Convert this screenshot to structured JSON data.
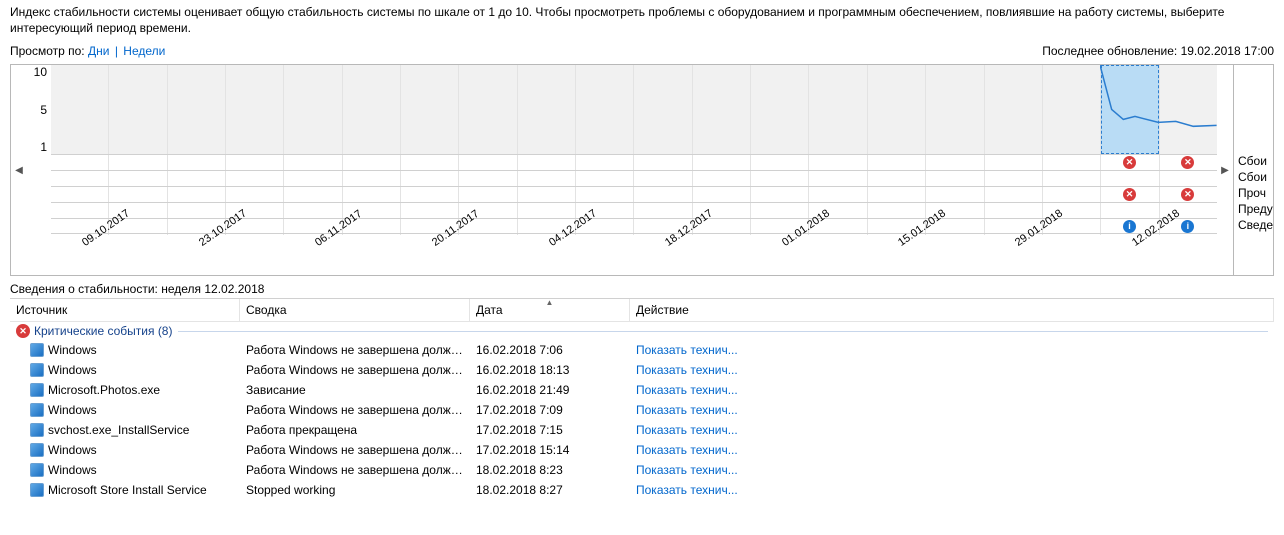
{
  "intro": "Индекс стабильности системы оценивает общую стабильность системы по шкале от 1 до 10. Чтобы просмотреть проблемы с оборудованием и программным обеспечением, повлиявшие на работу системы, выберите интересующий период времени.",
  "view_by_label": "Просмотр по:",
  "view_days": "Дни",
  "view_weeks": "Недели",
  "last_update_label": "Последнее обновление:",
  "last_update_value": "19.02.2018 17:00",
  "y_ticks": [
    "10",
    "5",
    "1"
  ],
  "date_labels": [
    "09.10.2017",
    "23.10.2017",
    "06.11.2017",
    "20.11.2017",
    "04.12.2017",
    "18.12.2017",
    "01.01.2018",
    "15.01.2018",
    "29.01.2018",
    "12.02.2018"
  ],
  "selected_col_index": 18,
  "row_legend": [
    "Сбои",
    "Сбои",
    "Проч",
    "Преду",
    "Сведе"
  ],
  "events": [
    {
      "col": 18,
      "row": 0,
      "kind": "err"
    },
    {
      "col": 19,
      "row": 0,
      "kind": "err"
    },
    {
      "col": 18,
      "row": 2,
      "kind": "err"
    },
    {
      "col": 19,
      "row": 2,
      "kind": "err"
    },
    {
      "col": 18,
      "row": 4,
      "kind": "info"
    },
    {
      "col": 19,
      "row": 4,
      "kind": "info"
    }
  ],
  "chart_data": {
    "type": "line",
    "ylim": [
      1,
      10
    ],
    "ylabel": "",
    "xlabel": "",
    "title": "",
    "x": [
      18,
      18.2,
      18.4,
      18.6,
      19,
      19.3,
      19.6,
      20
    ],
    "values": [
      10,
      5.5,
      4.5,
      4.8,
      4.2,
      4.3,
      3.8,
      3.9
    ]
  },
  "details_title_prefix": "Сведения о стабильности:",
  "details_title_period": "неделя 12.02.2018",
  "columns": {
    "source": "Источник",
    "summary": "Сводка",
    "date": "Дата",
    "action": "Действие"
  },
  "group": {
    "label": "Критические события",
    "count": "(8)"
  },
  "action_text": "Показать технич...",
  "rows": [
    {
      "source": "Windows",
      "summary": "Работа Windows не завершена должн...",
      "date": "16.02.2018 7:06"
    },
    {
      "source": "Windows",
      "summary": "Работа Windows не завершена должн...",
      "date": "16.02.2018 18:13"
    },
    {
      "source": "Microsoft.Photos.exe",
      "summary": "Зависание",
      "date": "16.02.2018 21:49"
    },
    {
      "source": "Windows",
      "summary": "Работа Windows не завершена должн...",
      "date": "17.02.2018 7:09"
    },
    {
      "source": "svchost.exe_InstallService",
      "summary": "Работа прекращена",
      "date": "17.02.2018 7:15"
    },
    {
      "source": "Windows",
      "summary": "Работа Windows не завершена должн...",
      "date": "17.02.2018 15:14"
    },
    {
      "source": "Windows",
      "summary": "Работа Windows не завершена должн...",
      "date": "18.02.2018 8:23"
    },
    {
      "source": "Microsoft Store Install Service",
      "summary": "Stopped working",
      "date": "18.02.2018 8:27"
    }
  ]
}
